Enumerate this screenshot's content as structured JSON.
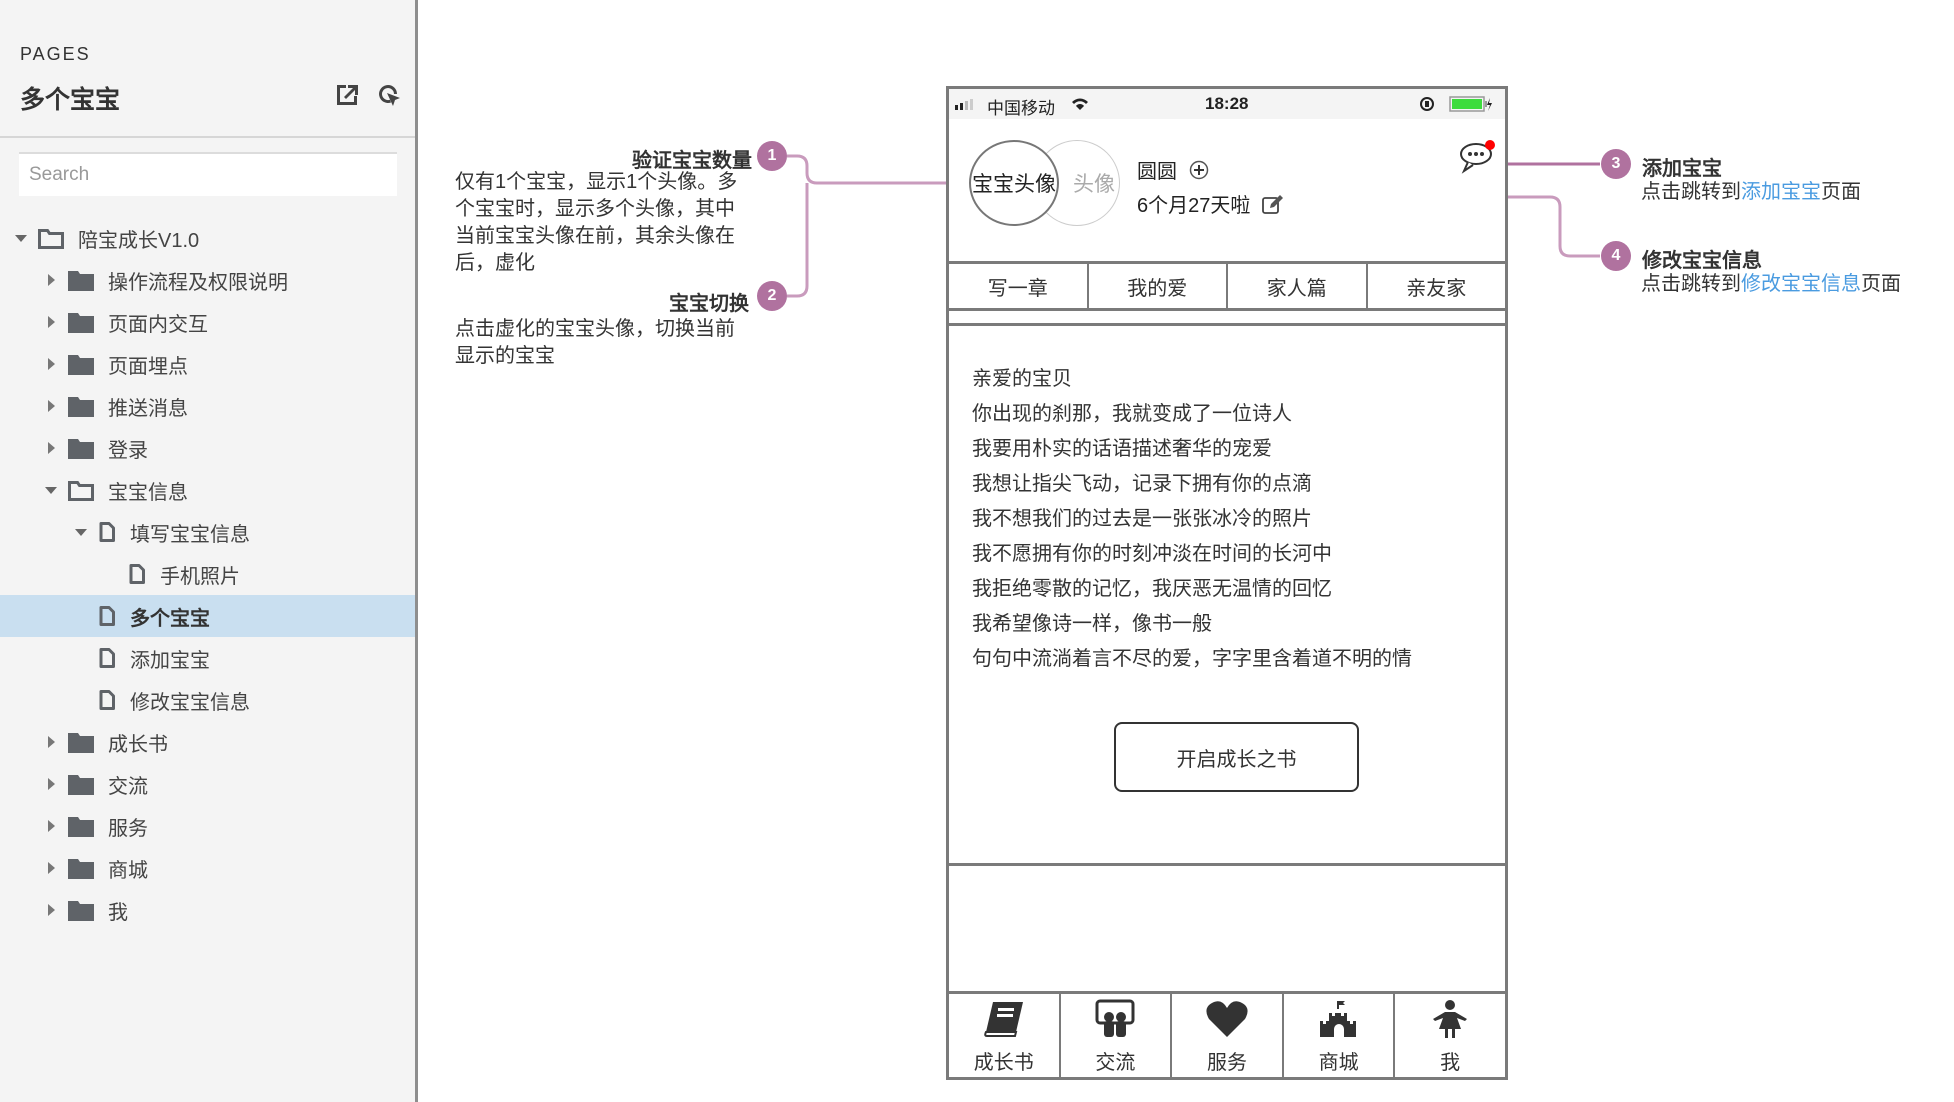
{
  "sidebar": {
    "section_label": "PAGES",
    "page_title": "多个宝宝",
    "search_placeholder": "Search",
    "tree": [
      {
        "label": "陪宝成长V1.0",
        "type": "folder-open",
        "expanded": true,
        "level": 0
      },
      {
        "label": "操作流程及权限说明",
        "type": "folder",
        "expanded": false,
        "level": 1
      },
      {
        "label": "页面内交互",
        "type": "folder",
        "expanded": false,
        "level": 1
      },
      {
        "label": "页面埋点",
        "type": "folder",
        "expanded": false,
        "level": 1
      },
      {
        "label": "推送消息",
        "type": "folder",
        "expanded": false,
        "level": 1
      },
      {
        "label": "登录",
        "type": "folder",
        "expanded": false,
        "level": 1
      },
      {
        "label": "宝宝信息",
        "type": "folder-open",
        "expanded": true,
        "level": 1
      },
      {
        "label": "填写宝宝信息",
        "type": "page",
        "expanded": true,
        "level": 2
      },
      {
        "label": "手机照片",
        "type": "page",
        "level": 3
      },
      {
        "label": "多个宝宝",
        "type": "page",
        "level": 2,
        "selected": true
      },
      {
        "label": "添加宝宝",
        "type": "page",
        "level": 2
      },
      {
        "label": "修改宝宝信息",
        "type": "page",
        "level": 2
      },
      {
        "label": "成长书",
        "type": "folder",
        "expanded": false,
        "level": 1
      },
      {
        "label": "交流",
        "type": "folder",
        "expanded": false,
        "level": 1
      },
      {
        "label": "服务",
        "type": "folder",
        "expanded": false,
        "level": 1
      },
      {
        "label": "商城",
        "type": "folder",
        "expanded": false,
        "level": 1
      },
      {
        "label": "我",
        "type": "folder",
        "expanded": false,
        "level": 1
      }
    ]
  },
  "annotations": [
    {
      "number": "1",
      "title": "验证宝宝数量",
      "body": [
        "仅有1个宝宝，显示1个头像。多",
        "个宝宝时，显示多个头像，其中",
        "当前宝宝头像在前，其余头像在",
        "后，虚化"
      ]
    },
    {
      "number": "2",
      "title": "宝宝切换",
      "body": [
        "点击虚化的宝宝头像，切换当前",
        "显示的宝宝"
      ]
    },
    {
      "number": "3",
      "title": "添加宝宝",
      "body_prefix": "点击跳转到",
      "link": "添加宝宝",
      "body_suffix": "页面"
    },
    {
      "number": "4",
      "title": "修改宝宝信息",
      "body_prefix": "点击跳转到",
      "link": "修改宝宝信息",
      "body_suffix": "页面"
    }
  ],
  "phone": {
    "status": {
      "carrier": "中国移动",
      "time": "18:28",
      "battery_color": "#3ddc3d"
    },
    "profile": {
      "avatar_current": "宝宝头像",
      "avatar_other": "头像",
      "name": "圆圆",
      "age": "6个月27天啦",
      "notification_dot_color": "#ff0000"
    },
    "tabs": [
      "写一章",
      "我的爱",
      "家人篇",
      "亲友家"
    ],
    "poem": [
      "亲爱的宝贝",
      "你出现的刹那，我就变成了一位诗人",
      "我要用朴实的话语描述奢华的宠爱",
      "我想让指尖飞动，记录下拥有你的点滴",
      "我不想我们的过去是一张张冰冷的照片",
      "我不愿拥有你的时刻冲淡在时间的长河中",
      "我拒绝零散的记忆，我厌恶无温情的回忆",
      "我希望像诗一样，像书一般",
      "句句中流淌着言不尽的爱，字字里含着道不明的情"
    ],
    "start_button": "开启成长之书",
    "bottom_nav": [
      {
        "label": "成长书",
        "icon": "book-icon"
      },
      {
        "label": "交流",
        "icon": "chat-people-icon"
      },
      {
        "label": "服务",
        "icon": "heart-icon"
      },
      {
        "label": "商城",
        "icon": "castle-icon"
      },
      {
        "label": "我",
        "icon": "person-icon"
      }
    ]
  },
  "colors": {
    "marker": "#b0729f",
    "connector": "#c99bbd",
    "link": "#4a9be0",
    "selected_row": "#c9dff0"
  }
}
